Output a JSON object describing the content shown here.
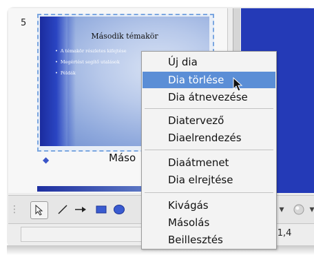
{
  "slide_panel": {
    "slide_number": "5",
    "thumbnail": {
      "title": "Második témakör",
      "bullets": [
        "A témakör részletes kifejtése",
        "Megértést segítő utalások",
        "Példák"
      ]
    },
    "slide_label": "Máso"
  },
  "context_menu": {
    "items": [
      {
        "label": "Új dia"
      },
      {
        "label": "Dia törlése",
        "highlighted": true
      },
      {
        "label": "Dia átnevezése"
      },
      {
        "label": "Diatervező"
      },
      {
        "label": "Diaelrendezés"
      },
      {
        "label": "Diaátmenet"
      },
      {
        "label": "Dia elrejtése"
      },
      {
        "label": "Kivágás"
      },
      {
        "label": "Másolás"
      },
      {
        "label": "Beillesztés"
      }
    ]
  },
  "toolbar": {
    "tools": [
      "select-tool",
      "line-tool",
      "arrow-tool",
      "rectangle-tool",
      "ellipse-tool"
    ]
  },
  "statusbar": {
    "coordinates": "-1,4"
  },
  "colors": {
    "menu_highlight": "#5b8ed6",
    "slide_blue": "#243ab7",
    "rect_tool": "#3a5bd0"
  }
}
